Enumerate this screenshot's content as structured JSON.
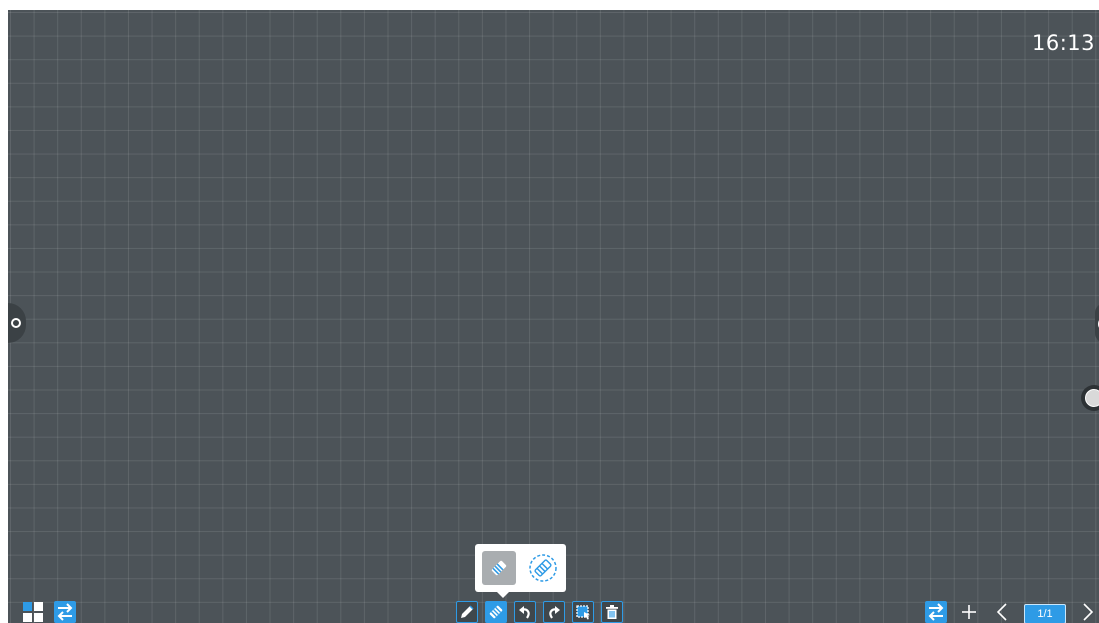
{
  "status": {
    "clock": "16:13"
  },
  "bottom_left": {
    "icons": [
      "apps-grid-icon",
      "switch-icon"
    ]
  },
  "bottom_center": {
    "tools": [
      "pen-icon",
      "eraser-icon",
      "undo-icon",
      "redo-icon",
      "select-icon",
      "delete-icon"
    ],
    "active_tool": "eraser-icon"
  },
  "eraser_popup": {
    "options": [
      "small-eraser-icon",
      "area-eraser-icon"
    ],
    "selected": "small-eraser-icon"
  },
  "bottom_right": {
    "icons": [
      "switch-icon",
      "add-page-icon",
      "prev-page-icon",
      "next-page-icon"
    ],
    "page_indicator": "1/1"
  },
  "colors": {
    "board": "#4c5358",
    "accent": "#2e9be6",
    "text": "#ffffff"
  }
}
